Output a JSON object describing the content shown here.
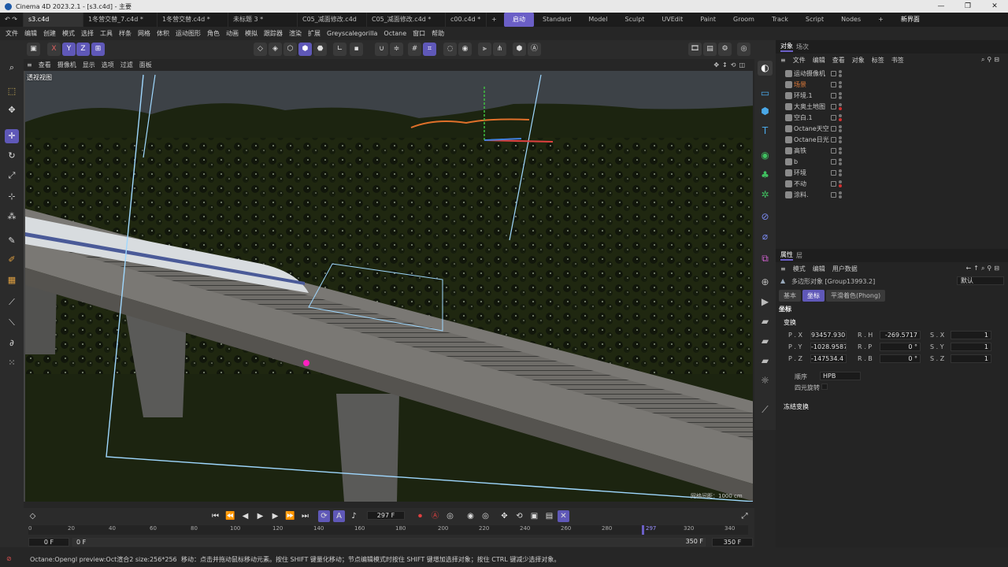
{
  "window": {
    "title": "Cinema 4D 2023.2.1 - [s3.c4d] - 主要",
    "controls": [
      "—",
      "❐",
      "✕"
    ]
  },
  "doc_tabs": [
    "s3.c4d",
    "1冬营交替_7.c4d *",
    "1冬营交替.c4d *",
    "未标题 3 *",
    "C05_减面修改.c4d",
    "C05_减面修改.c4d *",
    "c00.c4d *",
    "+"
  ],
  "layout_tabs": [
    "启动",
    "Standard",
    "Model",
    "Sculpt",
    "UVEdit",
    "Paint",
    "Groom",
    "Track",
    "Script",
    "Nodes",
    "+",
    "新界面"
  ],
  "menu": [
    "文件",
    "编辑",
    "创建",
    "模式",
    "选择",
    "工具",
    "样条",
    "网格",
    "体积",
    "运动图形",
    "角色",
    "动画",
    "模拟",
    "跟踪器",
    "渲染",
    "扩展",
    "Greyscalegorilla",
    "Octane",
    "窗口",
    "帮助"
  ],
  "toolbar": {
    "x": "X",
    "y": "Y",
    "z": "Z"
  },
  "viewport_menu": [
    "查看",
    "摄像机",
    "显示",
    "选项",
    "过滤",
    "面板"
  ],
  "viewport": {
    "label": "透视视图",
    "grid_spacing": "网格间距：1000 cm"
  },
  "object_panel": {
    "tabs": [
      "对象",
      "场次"
    ],
    "menu": [
      "文件",
      "编辑",
      "查看",
      "对象",
      "标签",
      "书签"
    ],
    "objects": [
      "运动摄像机",
      "场景",
      "环境.1",
      "大奥土地图",
      "空白.1",
      "Octane天空",
      "Octane日光",
      "高铁",
      "b",
      "环境",
      "不动",
      "涂料."
    ]
  },
  "attr_panel": {
    "tabs": [
      "属性",
      "层"
    ],
    "menu": [
      "模式",
      "编辑",
      "用户数据"
    ],
    "object_name": "多边形对象 [Group13993.2]",
    "preset": "默认",
    "subtabs": [
      "基本",
      "坐标",
      "平滑着色(Phong)"
    ],
    "section": "坐标",
    "transform_label": "变换",
    "coords": {
      "px": "93457.930",
      "py": "-1028.9587",
      "pz": "-147534.4",
      "rh": "-269.5717",
      "rp": "0 °",
      "rb": "0 °",
      "sx": "1",
      "sy": "1",
      "sz": "1"
    },
    "labels": {
      "px": "P . X",
      "py": "P . Y",
      "pz": "P . Z",
      "rh": "R . H",
      "rp": "R . P",
      "rb": "R . B",
      "sx": "S . X",
      "sy": "S . Y",
      "sz": "S . Z"
    },
    "order_label": "顺序",
    "order_value": "HPB",
    "quat_label": "四元旋转",
    "frozen_label": "冻结变换"
  },
  "timeline": {
    "current_frame": "297 F",
    "ticks": [
      "0",
      "20",
      "40",
      "60",
      "80",
      "100",
      "120",
      "140",
      "160",
      "180",
      "200",
      "220",
      "240",
      "260",
      "280",
      "297",
      "320",
      "340"
    ],
    "start_a": "0 F",
    "start_b": "0 F",
    "end_a": "350 F",
    "end_b": "350 F"
  },
  "status": {
    "render_info": "Octane:Opengl preview:Oct渲合2  size:256*256",
    "hint": "移动：点击并拖动鼠标移动元素。按住 SHIFT 键量化移动；节点编辑模式时按住 SHIFT 键增加选择对象；按住 CTRL 键减少选择对象。"
  },
  "colors": {
    "accent": "#6b5fc7",
    "selected_object": "#e07b3a"
  }
}
